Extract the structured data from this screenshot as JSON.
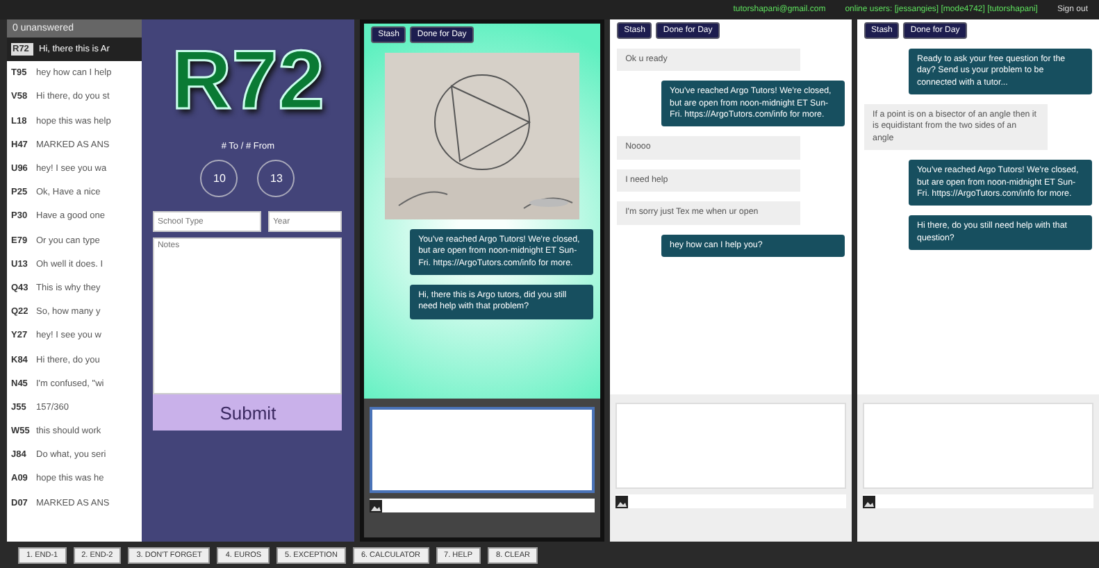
{
  "top_bar": {
    "email": "tutorshapani@gmail.com",
    "online_users": "online users: [jessangies] [mode4742] [tutorshapani]",
    "sign_out": "Sign out"
  },
  "queue": {
    "header": "0 unanswered",
    "rows": [
      {
        "code": "R72",
        "preview": "Hi, there this is Ar",
        "selected": true
      },
      {
        "code": "T95",
        "preview": "hey how can I help",
        "selected": false
      },
      {
        "code": "V58",
        "preview": "Hi there, do you st",
        "selected": false
      },
      {
        "code": "L18",
        "preview": "hope this was help",
        "selected": false
      },
      {
        "code": "H47",
        "preview": "MARKED AS ANS",
        "selected": false
      },
      {
        "code": "U96",
        "preview": "hey! I see you wa",
        "selected": false
      },
      {
        "code": "P25",
        "preview": "Ok, Have a nice",
        "selected": false
      },
      {
        "code": "P30",
        "preview": "Have a good one",
        "selected": false
      },
      {
        "code": "E79",
        "preview": "Or you can type",
        "selected": false
      },
      {
        "code": "U13",
        "preview": "Oh well it does. I",
        "selected": false
      },
      {
        "code": "Q43",
        "preview": "This is why they",
        "selected": false
      },
      {
        "code": "Q22",
        "preview": "So, how many y",
        "selected": false
      },
      {
        "code": "Y27",
        "preview": "hey! I see you w",
        "selected": false
      },
      {
        "code": "K84",
        "preview": "Hi there, do you",
        "selected": false
      },
      {
        "code": "N45",
        "preview": "I'm confused, \"wi",
        "selected": false
      },
      {
        "code": "J55",
        "preview": "157/360",
        "selected": false
      },
      {
        "code": "W55",
        "preview": "this should work",
        "selected": false
      },
      {
        "code": "J84",
        "preview": "Do what, you seri",
        "selected": false
      },
      {
        "code": "A09",
        "preview": "hope this was he",
        "selected": false
      },
      {
        "code": "D07",
        "preview": "MARKED AS ANS",
        "selected": false
      }
    ]
  },
  "student_card": {
    "room": "R72",
    "counts_label": "# To / # From",
    "to_count": "10",
    "from_count": "13",
    "school_type": {
      "placeholder": "School Type"
    },
    "year": {
      "placeholder": "Year"
    },
    "notes": {
      "placeholder": "Notes"
    },
    "submit": "Submit"
  },
  "chats": [
    {
      "selected": true,
      "buttons": [
        "Stash",
        "Done for Day"
      ],
      "messages": [
        {
          "kind": "picture"
        },
        {
          "kind": "tutor",
          "text": "You've reached Argo Tutors! We're closed, but are open from noon-midnight ET Sun-Fri. https://ArgoTutors.com/info for more."
        },
        {
          "kind": "tutor",
          "text": "Hi, there this is Argo tutors, did you still need help with that problem?"
        }
      ]
    },
    {
      "selected": false,
      "buttons": [
        "Stash",
        "Done for Day"
      ],
      "messages": [
        {
          "kind": "student",
          "text": "Ok u ready"
        },
        {
          "kind": "tutor",
          "text": "You've reached Argo Tutors! We're closed, but are open from noon-midnight ET Sun-Fri. https://ArgoTutors.com/info for more."
        },
        {
          "kind": "student",
          "text": "Noooo"
        },
        {
          "kind": "student",
          "text": "I need help"
        },
        {
          "kind": "student",
          "text": "I'm sorry just Tex me when ur open"
        },
        {
          "kind": "tutor",
          "text": "hey how can I help you?"
        }
      ]
    },
    {
      "selected": false,
      "buttons": [
        "Stash",
        "Done for Day"
      ],
      "messages": [
        {
          "kind": "tutor",
          "text": "Ready to ask your free question for the day? Send us your problem to be connected with a tutor..."
        },
        {
          "kind": "student",
          "text": "If a point is on a bisector of an angle then it is equidistant from the two sides of an angle"
        },
        {
          "kind": "tutor",
          "text": "You've reached Argo Tutors! We're closed, but are open from noon-midnight ET Sun-Fri. https://ArgoTutors.com/info for more."
        },
        {
          "kind": "tutor",
          "text": "Hi there, do you still need help with that question?"
        }
      ]
    }
  ],
  "hotkeys": [
    "1. END-1",
    "2. END-2",
    "3. DON'T FORGET",
    "4. EUROS",
    "5. EXCEPTION",
    "6. CALCULATOR",
    "7. HELP",
    "8. CLEAR"
  ]
}
